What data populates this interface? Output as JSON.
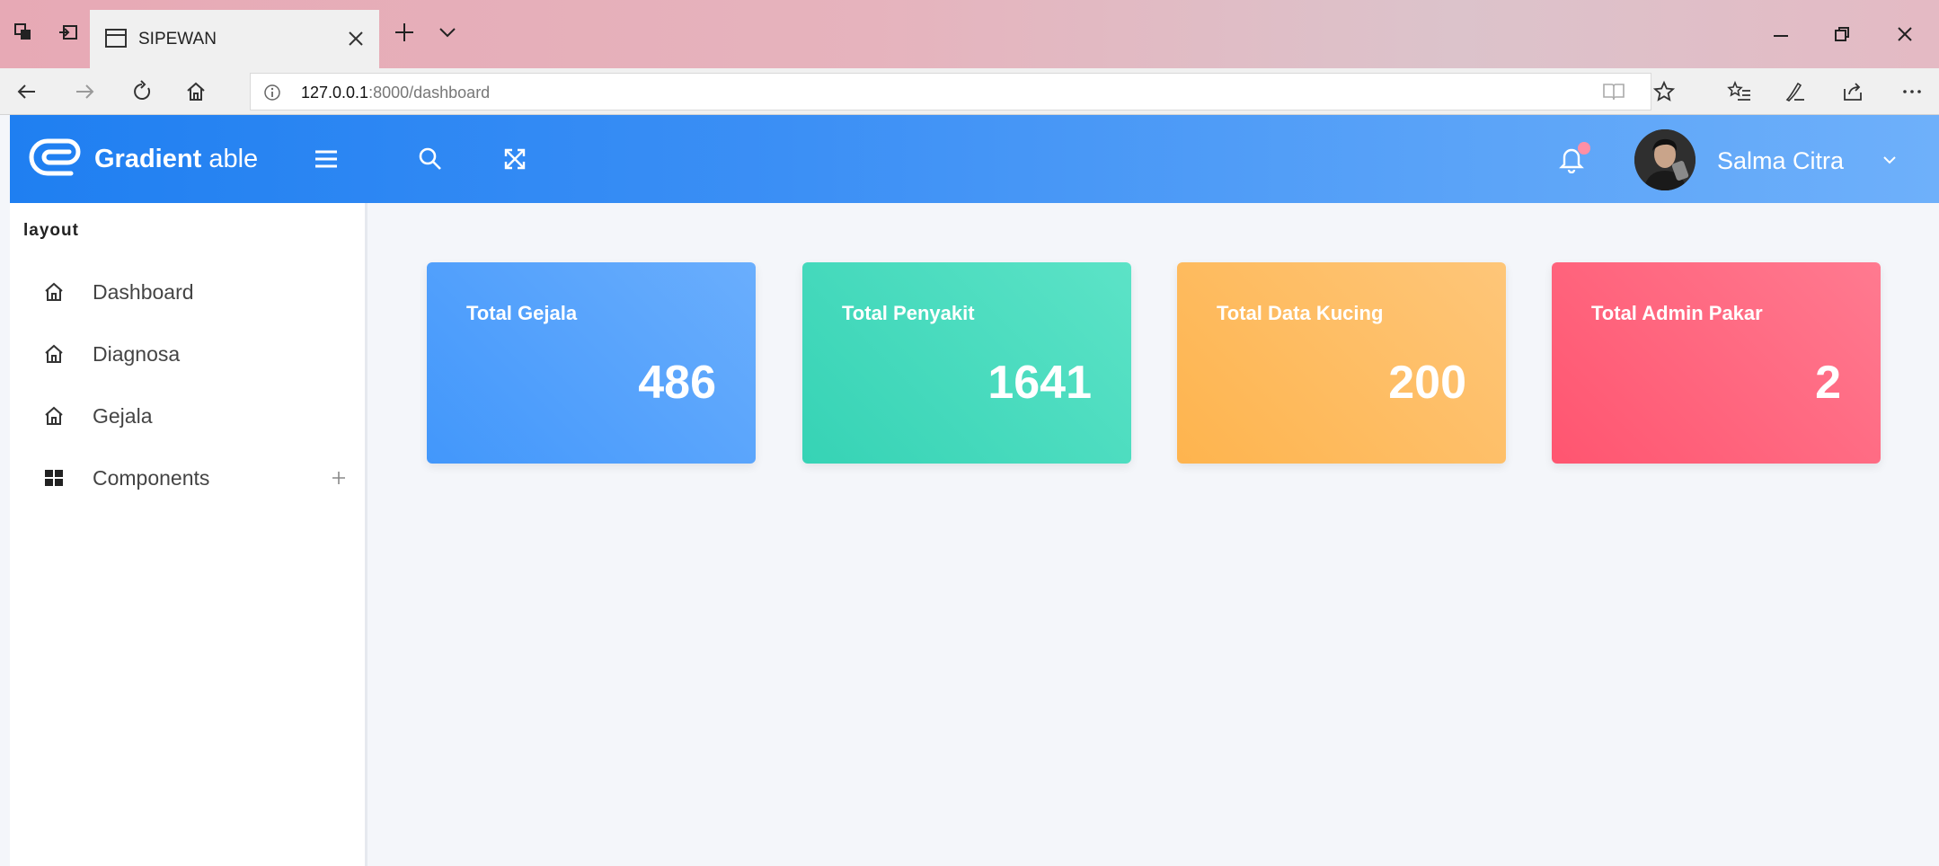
{
  "browser": {
    "tab_title": "SIPEWAN",
    "url_host": "127.0.0.1",
    "url_rest": ":8000/dashboard"
  },
  "header": {
    "logo_bold": "Gradient",
    "logo_light": "able",
    "user_name": "Salma Citra"
  },
  "sidebar": {
    "section_label": "layout",
    "items": [
      {
        "label": "Dashboard",
        "icon": "home-icon"
      },
      {
        "label": "Diagnosa",
        "icon": "home-icon"
      },
      {
        "label": "Gejala",
        "icon": "home-icon"
      },
      {
        "label": "Components",
        "icon": "grid-icon"
      }
    ]
  },
  "cards": [
    {
      "title": "Total Gejala",
      "value": "486",
      "color_from": "#4297fb",
      "color_to": "#6aaefd"
    },
    {
      "title": "Total Penyakit",
      "value": "1641",
      "color_from": "#36d3b5",
      "color_to": "#5ce3c7"
    },
    {
      "title": "Total Data Kucing",
      "value": "200",
      "color_from": "#feb44e",
      "color_to": "#fec679"
    },
    {
      "title": "Total Admin Pakar",
      "value": "2",
      "color_from": "#ff5570",
      "color_to": "#ff7a90"
    }
  ],
  "colors": {
    "header_gradient_start": "#1f7ff1",
    "header_gradient_end": "#6eb0fa",
    "page_background": "#f4f6fa"
  }
}
